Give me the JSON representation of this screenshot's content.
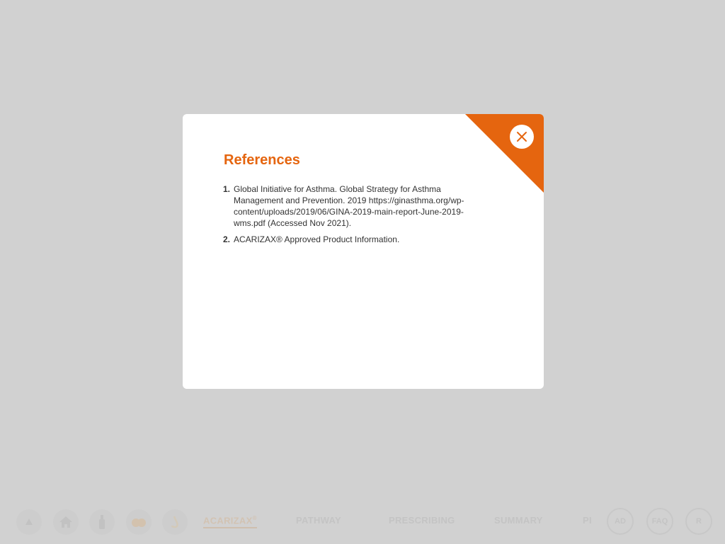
{
  "modal": {
    "title": "References",
    "close_icon": "close-icon",
    "references": [
      {
        "number": "1.",
        "text": "Global Initiative for Asthma. Global Strategy for Asthma Management and Prevention. 2019 https://ginasthma.org/wp-content/uploads/2019/06/GINA-2019-main-report-June-2019-wms.pdf (Accessed Nov 2021)."
      },
      {
        "number": "2.",
        "text": "ACARIZAX® Approved Product Information."
      }
    ]
  },
  "nav": {
    "icons": [
      "up-arrow-icon",
      "home-icon",
      "bottle-icon",
      "lungs-icon",
      "nose-icon"
    ],
    "links": [
      {
        "label": "ACARIZAX",
        "sup": "®",
        "active": true
      },
      {
        "label": "PATHWAY"
      },
      {
        "label": "PRESCRIBING"
      },
      {
        "label": "SUMMARY"
      },
      {
        "label": "PI"
      }
    ],
    "round_buttons": [
      "AD",
      "FAQ",
      "R"
    ]
  },
  "colors": {
    "accent": "#e5650f",
    "overlay": "#d1d1d1",
    "text": "#333333"
  }
}
